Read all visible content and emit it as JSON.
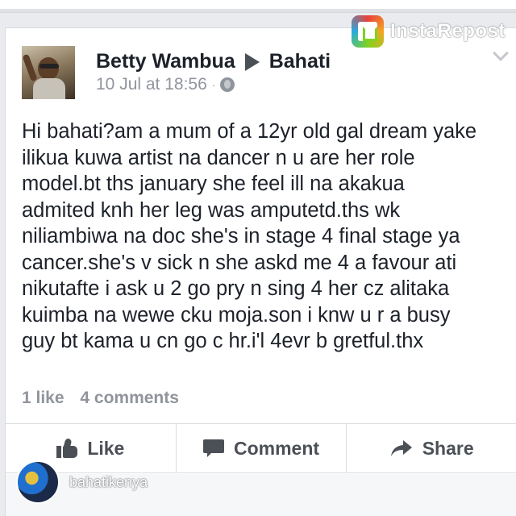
{
  "watermark": {
    "app_name": "InstaRepost",
    "username": "bahatikenya"
  },
  "post": {
    "author": "Betty Wambua",
    "target": "Bahati",
    "timestamp": "10 Jul at 18:56",
    "separator": "·",
    "privacy_icon": "globe-icon",
    "text_lines": [
      "Hi bahati?am a mum of a 12yr old gal dream yake",
      "ilikua kuwa artist na dancer n u are her role",
      "model.bt ths january she feel ill na akakua",
      "admited knh her leg was amputetd.ths wk",
      "niliambiwa na doc she's in stage 4 final stage ya",
      "cancer.she's v sick n she askd me 4 a favour ati",
      "nikutafte i ask u 2 go pry n sing 4 her cz alitaka",
      "kuimba na wewe cku moja.son i knw u r a busy",
      "guy bt kama u cn go c hr.i'l 4evr b gretful.thx"
    ],
    "likes": "1 like",
    "comments": "4 comments"
  },
  "actions": {
    "like": "Like",
    "comment": "Comment",
    "share": "Share"
  },
  "colors": {
    "text": "#1d2129",
    "secondary": "#90949c",
    "action": "#4b4f56",
    "background": "#e9ebee"
  }
}
